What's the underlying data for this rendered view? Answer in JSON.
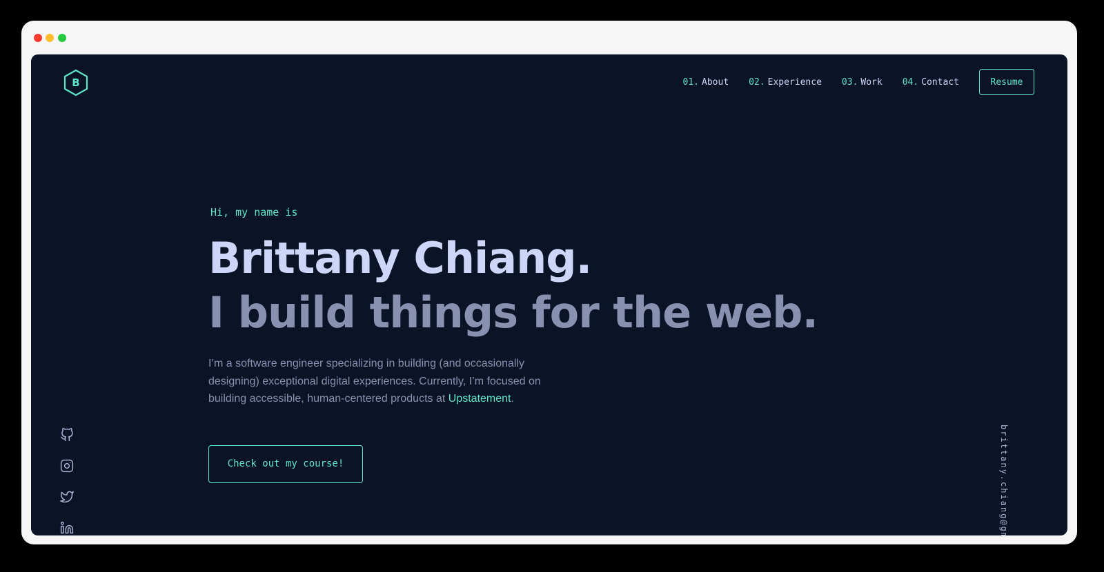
{
  "window": {
    "controls": [
      "close",
      "minimize",
      "zoom"
    ]
  },
  "logo": {
    "letter": "B",
    "icon": "hexagon-icon"
  },
  "nav": {
    "items": [
      {
        "num": "01.",
        "label": "About"
      },
      {
        "num": "02.",
        "label": "Experience"
      },
      {
        "num": "03.",
        "label": "Work"
      },
      {
        "num": "04.",
        "label": "Contact"
      }
    ],
    "resume_label": "Resume"
  },
  "hero": {
    "greeting": "Hi, my name is",
    "name": "Brittany Chiang.",
    "tagline": "I build things for the web.",
    "description_before": "I’m a software engineer specializing in building (and occasionally designing) exceptional digital experiences. Currently, I’m focused on building accessible, human-centered products at ",
    "description_link": "Upstatement",
    "description_after": ".",
    "cta_label": "Check out my course!"
  },
  "social": {
    "icons": [
      "github-icon",
      "instagram-icon",
      "twitter-icon",
      "linkedin-icon"
    ]
  },
  "email": {
    "text": "brittany.chiang@gmail.com"
  },
  "colors": {
    "background": "#0b1326",
    "accent": "#5ee6c9",
    "heading": "#ccd6f6",
    "muted": "#8892b0"
  }
}
